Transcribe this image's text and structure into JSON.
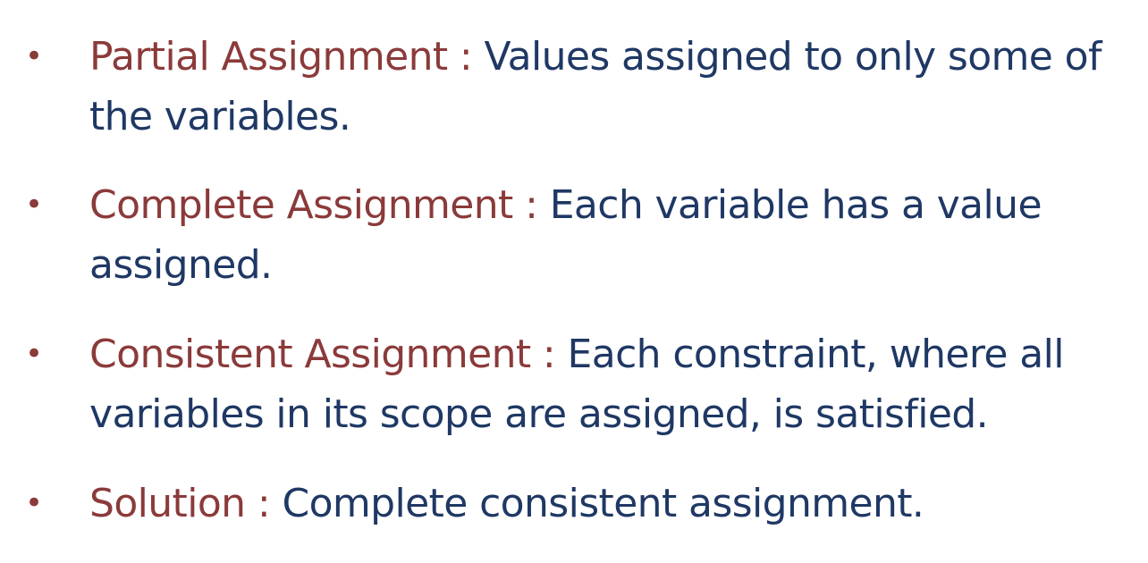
{
  "bullets": [
    {
      "term": "Partial Assignment :  ",
      "definition": "Values assigned to only some of the variables."
    },
    {
      "term": "Complete Assignment :  ",
      "definition": "Each variable has a value assigned."
    },
    {
      "term": "Consistent  Assignment :  ",
      "definition": "Each constraint, where all variables in its scope are assigned, is satisfied."
    },
    {
      "term": "Solution :  ",
      "definition": "Complete consistent assignment."
    }
  ],
  "bullet_symbol": "•",
  "colors": {
    "term": "#8b3a3a",
    "definition": "#1f3864",
    "bullet": "#8b3a3a",
    "background": "#ffffff"
  }
}
